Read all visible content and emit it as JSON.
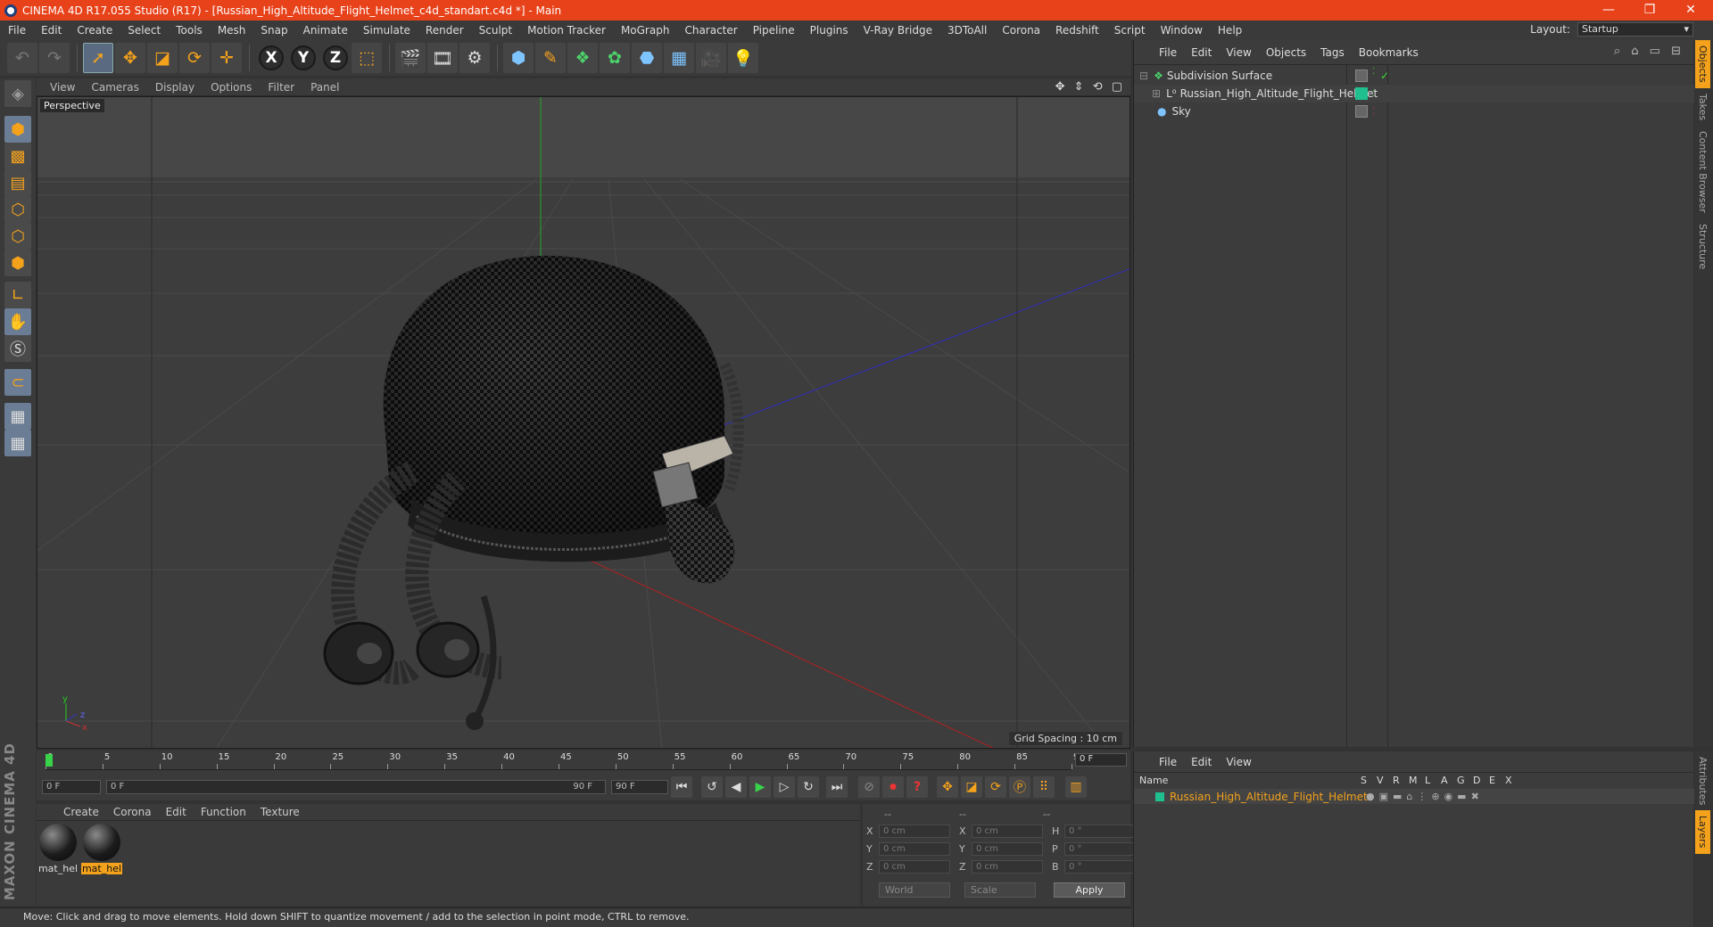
{
  "window": {
    "title": "CINEMA 4D R17.055 Studio (R17) - [Russian_High_Altitude_Flight_Helmet_c4d_standart.c4d *] - Main",
    "controls": [
      "—",
      "❐",
      "✕"
    ]
  },
  "menubar": [
    "File",
    "Edit",
    "Create",
    "Select",
    "Tools",
    "Mesh",
    "Snap",
    "Animate",
    "Simulate",
    "Render",
    "Sculpt",
    "Motion Tracker",
    "MoGraph",
    "Character",
    "Pipeline",
    "Plugins",
    "V-Ray Bridge",
    "3DToAll",
    "Corona",
    "Redshift",
    "Script",
    "Window",
    "Help"
  ],
  "layout": {
    "label": "Layout:",
    "value": "Startup"
  },
  "toolbar": {
    "axis_x": "X",
    "axis_y": "Y",
    "axis_z": "Z"
  },
  "left_tools": {
    "logo": "MAXON CINEMA 4D"
  },
  "viewport": {
    "menu": [
      "View",
      "Cameras",
      "Display",
      "Options",
      "Filter",
      "Panel"
    ],
    "camera_label": "Perspective",
    "grid_spacing": "Grid Spacing : 10 cm",
    "nav_icons": "✥ ⇕ ⟲ ▢"
  },
  "timeline": {
    "ticks": [
      "0",
      "5",
      "10",
      "15",
      "20",
      "25",
      "30",
      "35",
      "40",
      "45",
      "50",
      "55",
      "60",
      "65",
      "70",
      "75",
      "80",
      "85",
      "90"
    ],
    "current_frame": "0 F",
    "start": "0 F",
    "range_start": "0 F",
    "range_end": "90 F",
    "end": "90 F"
  },
  "material_manager": {
    "menu": [
      "Create",
      "Corona",
      "Edit",
      "Function",
      "Texture"
    ],
    "materials": [
      {
        "name": "mat_hel",
        "selected": false
      },
      {
        "name": "mat_hel",
        "selected": true
      }
    ]
  },
  "coordinates": {
    "header": [
      "--",
      "--",
      "--"
    ],
    "rows": [
      {
        "l1": "X",
        "v1": "0 cm",
        "l2": "X",
        "v2": "0 cm",
        "l3": "H",
        "v3": "0 °"
      },
      {
        "l1": "Y",
        "v1": "0 cm",
        "l2": "Y",
        "v2": "0 cm",
        "l3": "P",
        "v3": "0 °"
      },
      {
        "l1": "Z",
        "v1": "0 cm",
        "l2": "Z",
        "v2": "0 cm",
        "l3": "B",
        "v3": "0 °"
      }
    ],
    "world": "World",
    "scale": "Scale",
    "apply": "Apply"
  },
  "status": "Move: Click and drag to move elements. Hold down SHIFT to quantize movement / add to the selection in point mode, CTRL to remove.",
  "object_manager": {
    "menu": [
      "File",
      "Edit",
      "View",
      "Objects",
      "Tags",
      "Bookmarks"
    ],
    "objects": [
      {
        "name": "Subdivision Surface",
        "indent": 0
      },
      {
        "name": "Russian_High_Altitude_Flight_Helmet",
        "indent": 1
      },
      {
        "name": "Sky",
        "indent": 0
      }
    ]
  },
  "right_tabs": [
    "Objects",
    "Takes",
    "Content Browser",
    "Structure"
  ],
  "layer_manager": {
    "menu": [
      "File",
      "Edit",
      "View"
    ],
    "columns": [
      "Name",
      "S",
      "V",
      "R",
      "M",
      "L",
      "A",
      "G",
      "D",
      "E",
      "X"
    ],
    "layer": "Russian_High_Altitude_Flight_Helmet",
    "layer_color": "#1fbf8f"
  },
  "right_tabs2": [
    "Attributes",
    "Layers"
  ],
  "colors": {
    "accent": "#f4a21c",
    "title_bar": "#e8421a"
  }
}
